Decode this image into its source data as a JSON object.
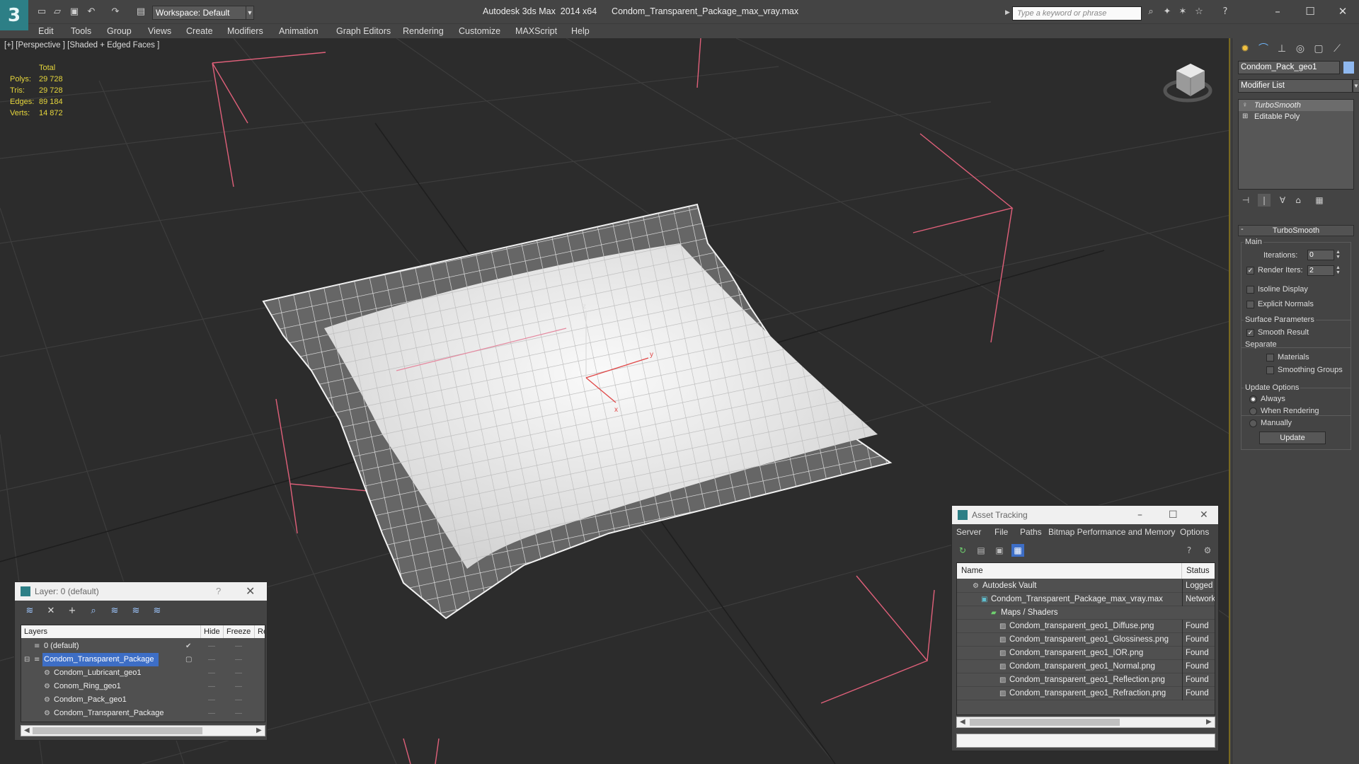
{
  "titlebar": {
    "workspace": "Workspace: Default",
    "app_title": "Autodesk 3ds Max  2014 x64      Condom_Transparent_Package_max_vray.max",
    "search_placeholder": "Type a keyword or phrase"
  },
  "menu": {
    "items": [
      "Edit",
      "Tools",
      "Group",
      "Views",
      "Create",
      "Modifiers",
      "Animation",
      "Graph Editors",
      "Rendering",
      "Customize",
      "MAXScript",
      "Help"
    ]
  },
  "viewport": {
    "label": "[+] [Perspective ] [Shaded + Edged Faces ]",
    "stats": {
      "header": "Total",
      "rows": [
        {
          "key": "Polys:",
          "value": "29 728"
        },
        {
          "key": "Tris:",
          "value": "29 728"
        },
        {
          "key": "Edges:",
          "value": "89 184"
        },
        {
          "key": "Verts:",
          "value": "14 872"
        }
      ]
    },
    "gizmo_axes": [
      "z",
      "y",
      "x"
    ]
  },
  "command_panel": {
    "object_name": "Condom_Pack_geo1",
    "object_color": "#8fb8ef",
    "modifier_list": "Modifier List",
    "stack": [
      "TurboSmooth",
      "Editable Poly"
    ],
    "rollout": {
      "title": "TurboSmooth",
      "main_label": "Main",
      "iterations_label": "Iterations:",
      "iterations_value": "0",
      "render_iters_label": "Render Iters:",
      "render_iters_value": "2",
      "isoline_label": "Isoline Display",
      "explicit_normals_label": "Explicit Normals",
      "surface_params_label": "Surface Parameters",
      "smooth_result_label": "Smooth Result",
      "separate_label": "Separate",
      "materials_label": "Materials",
      "smoothing_groups_label": "Smoothing Groups",
      "update_options_label": "Update Options",
      "always_label": "Always",
      "when_rendering_label": "When Rendering",
      "manually_label": "Manually",
      "update_button": "Update"
    }
  },
  "layer_window": {
    "title": "Layer: 0 (default)",
    "help": "?",
    "columns": [
      "Layers",
      "Hide",
      "Freeze",
      "Re"
    ],
    "rows": [
      {
        "name": "0 (default)",
        "indent": 0,
        "selected": false
      },
      {
        "name": "Condom_Transparent_Package",
        "indent": 0,
        "selected": true
      },
      {
        "name": "Condom_Lubricant_geo1",
        "indent": 1,
        "selected": false
      },
      {
        "name": "Conom_Ring_geo1",
        "indent": 1,
        "selected": false
      },
      {
        "name": "Condom_Pack_geo1",
        "indent": 1,
        "selected": false
      },
      {
        "name": "Condom_Transparent_Package",
        "indent": 1,
        "selected": false
      }
    ]
  },
  "asset_window": {
    "title": "Asset Tracking",
    "menu": [
      "Server",
      "File",
      "Paths",
      "Bitmap Performance and Memory",
      "Options"
    ],
    "columns": [
      "Name",
      "Status"
    ],
    "rows": [
      {
        "name": "Autodesk Vault",
        "status": "Logged",
        "indent": 0
      },
      {
        "name": "Condom_Transparent_Package_max_vray.max",
        "status": "Network",
        "indent": 1
      },
      {
        "name": "Maps / Shaders",
        "status": "",
        "indent": 2
      },
      {
        "name": "Condom_transparent_geo1_Diffuse.png",
        "status": "Found",
        "indent": 3
      },
      {
        "name": "Condom_transparent_geo1_Glossiness.png",
        "status": "Found",
        "indent": 3
      },
      {
        "name": "Condom_transparent_geo1_IOR.png",
        "status": "Found",
        "indent": 3
      },
      {
        "name": "Condom_transparent_geo1_Normal.png",
        "status": "Found",
        "indent": 3
      },
      {
        "name": "Condom_transparent_geo1_Reflection.png",
        "status": "Found",
        "indent": 3
      },
      {
        "name": "Condom_transparent_geo1_Refraction.png",
        "status": "Found",
        "indent": 3
      }
    ]
  }
}
